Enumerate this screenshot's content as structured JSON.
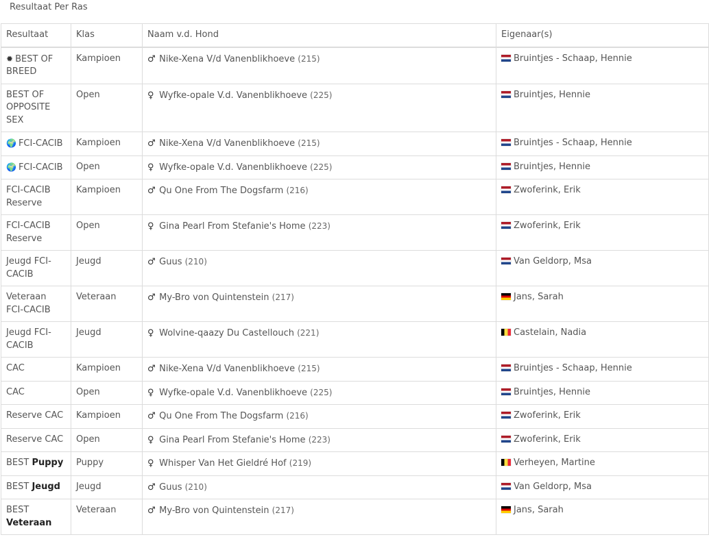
{
  "page": {
    "heading": "Resultaat Per Ras"
  },
  "table": {
    "headers": {
      "resultaat": "Resultaat",
      "klas": "Klas",
      "naam": "Naam v.d. Hond",
      "eigenaar": "Eigenaar(s)"
    },
    "rows": [
      {
        "result_prefix": "BEST OF BREED",
        "result_bold": "",
        "result_icon": "star-burst-icon",
        "klas": "Kampioen",
        "sex": "male",
        "sex_symbol": "♂",
        "dog": "Nike-Xena V/d Vanenblikhoeve",
        "catno": "(215)",
        "flag": "nl",
        "owner": "Bruintjes - Schaap, Hennie"
      },
      {
        "result_prefix": "BEST OF OPPOSITE SEX",
        "result_bold": "",
        "result_icon": "",
        "klas": "Open",
        "sex": "female",
        "sex_symbol": "♀",
        "dog": "Wyfke-opale V.d. Vanenblikhoeve",
        "catno": "(225)",
        "flag": "nl",
        "owner": "Bruintjes, Hennie"
      },
      {
        "result_prefix": "FCI-CACIB",
        "result_bold": "",
        "result_icon": "globe-icon",
        "klas": "Kampioen",
        "sex": "male",
        "sex_symbol": "♂",
        "dog": "Nike-Xena V/d Vanenblikhoeve",
        "catno": "(215)",
        "flag": "nl",
        "owner": "Bruintjes - Schaap, Hennie"
      },
      {
        "result_prefix": "FCI-CACIB",
        "result_bold": "",
        "result_icon": "globe-icon",
        "klas": "Open",
        "sex": "female",
        "sex_symbol": "♀",
        "dog": "Wyfke-opale V.d. Vanenblikhoeve",
        "catno": "(225)",
        "flag": "nl",
        "owner": "Bruintjes, Hennie"
      },
      {
        "result_prefix": "FCI-CACIB Reserve",
        "result_bold": "",
        "result_icon": "",
        "klas": "Kampioen",
        "sex": "male",
        "sex_symbol": "♂",
        "dog": "Qu One From The Dogsfarm",
        "catno": "(216)",
        "flag": "nl",
        "owner": "Zwoferink, Erik"
      },
      {
        "result_prefix": "FCI-CACIB Reserve",
        "result_bold": "",
        "result_icon": "",
        "klas": "Open",
        "sex": "female",
        "sex_symbol": "♀",
        "dog": "Gina Pearl From Stefanie's Home",
        "catno": "(223)",
        "flag": "nl",
        "owner": "Zwoferink, Erik"
      },
      {
        "result_prefix": "Jeugd FCI-CACIB",
        "result_bold": "",
        "result_icon": "",
        "klas": "Jeugd",
        "sex": "male",
        "sex_symbol": "♂",
        "dog": "Guus",
        "catno": "(210)",
        "flag": "nl",
        "owner": "Van Geldorp, Msa"
      },
      {
        "result_prefix": "Veteraan FCI-CACIB",
        "result_bold": "",
        "result_icon": "",
        "klas": "Veteraan",
        "sex": "male",
        "sex_symbol": "♂",
        "dog": "My-Bro von Quintenstein",
        "catno": "(217)",
        "flag": "de",
        "owner": "Jans, Sarah"
      },
      {
        "result_prefix": "Jeugd FCI-CACIB",
        "result_bold": "",
        "result_icon": "",
        "klas": "Jeugd",
        "sex": "female",
        "sex_symbol": "♀",
        "dog": "Wolvine-qaazy Du Castellouch",
        "catno": "(221)",
        "flag": "be",
        "owner": "Castelain, Nadia"
      },
      {
        "result_prefix": "CAC",
        "result_bold": "",
        "result_icon": "",
        "klas": "Kampioen",
        "sex": "male",
        "sex_symbol": "♂",
        "dog": "Nike-Xena V/d Vanenblikhoeve",
        "catno": "(215)",
        "flag": "nl",
        "owner": "Bruintjes - Schaap, Hennie"
      },
      {
        "result_prefix": "CAC",
        "result_bold": "",
        "result_icon": "",
        "klas": "Open",
        "sex": "female",
        "sex_symbol": "♀",
        "dog": "Wyfke-opale V.d. Vanenblikhoeve",
        "catno": "(225)",
        "flag": "nl",
        "owner": "Bruintjes, Hennie"
      },
      {
        "result_prefix": "Reserve CAC",
        "result_bold": "",
        "result_icon": "",
        "klas": "Kampioen",
        "sex": "male",
        "sex_symbol": "♂",
        "dog": "Qu One From The Dogsfarm",
        "catno": "(216)",
        "flag": "nl",
        "owner": "Zwoferink, Erik"
      },
      {
        "result_prefix": "Reserve CAC",
        "result_bold": "",
        "result_icon": "",
        "klas": "Open",
        "sex": "female",
        "sex_symbol": "♀",
        "dog": "Gina Pearl From Stefanie's Home",
        "catno": "(223)",
        "flag": "nl",
        "owner": "Zwoferink, Erik"
      },
      {
        "result_prefix": "BEST",
        "result_bold": "Puppy",
        "result_icon": "",
        "klas": "Puppy",
        "sex": "female",
        "sex_symbol": "♀",
        "dog": "Whisper Van Het Gieldré Hof",
        "catno": "(219)",
        "flag": "be",
        "owner": "Verheyen, Martine"
      },
      {
        "result_prefix": "BEST",
        "result_bold": "Jeugd",
        "result_icon": "",
        "klas": "Jeugd",
        "sex": "male",
        "sex_symbol": "♂",
        "dog": "Guus",
        "catno": "(210)",
        "flag": "nl",
        "owner": "Van Geldorp, Msa"
      },
      {
        "result_prefix": "BEST",
        "result_bold": "Veteraan",
        "result_icon": "",
        "klas": "Veteraan",
        "sex": "male",
        "sex_symbol": "♂",
        "dog": "My-Bro von Quintenstein",
        "catno": "(217)",
        "flag": "de",
        "owner": "Jans, Sarah"
      }
    ]
  },
  "icons": {
    "star-burst-icon": "✹",
    "globe-icon": "🌍"
  },
  "colors": {
    "text": "#555555",
    "border": "#dcdcdc",
    "nl": [
      "#ae1c28",
      "#ffffff",
      "#21468b"
    ],
    "de": [
      "#000000",
      "#dd0000",
      "#ffce00"
    ],
    "be": [
      "#000000",
      "#fae042",
      "#ed2939"
    ]
  }
}
